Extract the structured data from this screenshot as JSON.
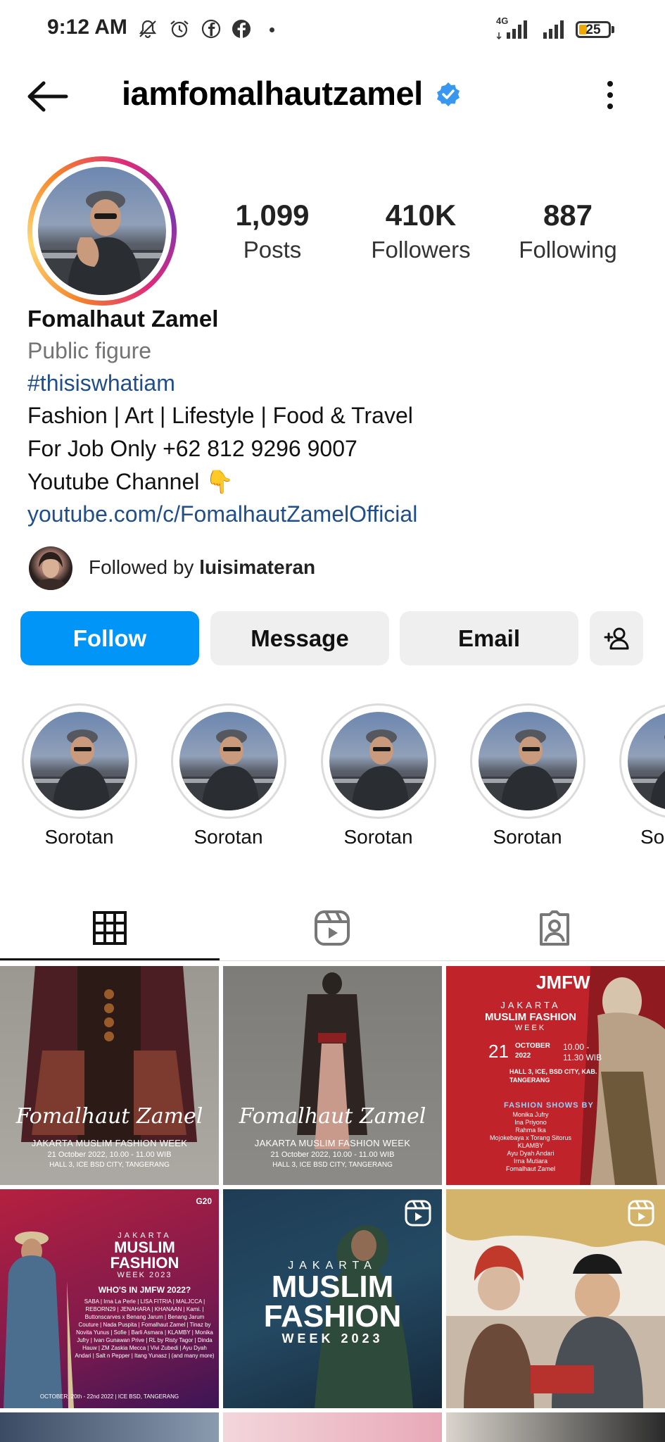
{
  "status_bar": {
    "time": "9:12 AM",
    "icons": [
      "mute-icon",
      "alarm-icon",
      "facebook-icon",
      "facebook-icon",
      "dot-icon",
      "signal-4g-icon",
      "signal-icon"
    ],
    "network": "4G",
    "battery": "25"
  },
  "header": {
    "back_icon": "arrow-left-icon",
    "username": "iamfomalhautzamel",
    "verified_icon": "verified-badge-icon",
    "menu_icon": "more-vertical-icon"
  },
  "profile": {
    "stats": [
      {
        "value": "1,099",
        "label": "Posts"
      },
      {
        "value": "410K",
        "label": "Followers"
      },
      {
        "value": "887",
        "label": "Following"
      }
    ],
    "name": "Fomalhaut Zamel",
    "category": "Public figure",
    "hashtag": "#thisiswhatiam",
    "bio_lines": [
      "Fashion | Art | Lifestyle | Food & Travel",
      "For Job Only +62 812 9296 9007",
      "Youtube Channel 👇"
    ],
    "link": "youtube.com/c/FomalhautZamelOfficial",
    "followed_by_prefix": "Followed by",
    "followed_by_user": "luisimateran"
  },
  "actions": {
    "follow": "Follow",
    "message": "Message",
    "email": "Email",
    "suggest_icon": "add-person-icon"
  },
  "highlights": [
    {
      "label": "Sorotan"
    },
    {
      "label": "Sorotan"
    },
    {
      "label": "Sorotan"
    },
    {
      "label": "Sorotan"
    },
    {
      "label": "Sorotan"
    }
  ],
  "tabs": [
    {
      "icon": "grid-icon",
      "active": true
    },
    {
      "icon": "reels-icon",
      "active": false
    },
    {
      "icon": "tagged-icon",
      "active": false
    }
  ],
  "posts": [
    {
      "script": "Fomalhaut Zamel",
      "line1": "JAKARTA MUSLIM FASHION WEEK",
      "line2": "21 October 2022, 10.00 - 11.00 WIB",
      "line3": "HALL 3, ICE BSD CITY, TANGERANG"
    },
    {
      "script": "Fomalhaut Zamel",
      "line1": "JAKARTA MUSLIM FASHION WEEK",
      "line2": "21 October 2022, 10.00 - 11.00 WIB",
      "line3": "HALL 3, ICE BSD CITY, TANGERANG"
    },
    {
      "brand": "JMFW",
      "title1": "JAKARTA",
      "title2": "MUSLIM FASHION",
      "title3": "WEEK",
      "day": "21",
      "month": "OCTOBER",
      "year": "2022",
      "time": "10.00 - 11.30 WIB",
      "venue": "HALL 3, ICE, BSD CITY, KAB. TANGERANG",
      "shows_title": "FASHION SHOWS BY",
      "shows": [
        "Monika Jufry",
        "Ina Priyono",
        "Rahma Ika",
        "Mojokebaya x Torang Sitorus",
        "KLAMBY",
        "Ayu Dyah Andari",
        "Irna Mutiara",
        "Fomalhaut Zamel"
      ]
    },
    {
      "title1": "JAKARTA",
      "title2": "MUSLIM",
      "title3": "FASHION",
      "title4": "WEEK 2023",
      "question": "WHO'S IN JMFW 2022?",
      "names": "SABA | Irna La Perle | LISA FITRIA | MALJCCA | REBORN29 | JENAHARA | KHANAAN | Kami. | Buttonscarves x Benang Jarum | Benang Jarum Couture | Nada Puspita | Fomalhaut Zamel | Tinaz by Novita Yunus | Sofie | Barli Asmara | KLAMBY | Monika Jufry | Ivan Gunawan Prive | RL by Risty Tagor | Dinda Hauw | ZM Zaskia Mecca | Vivi Zubedi | Ayu Dyah Andari | Salt n Pepper | Itang Yunasz | (and many more)",
      "date": "OCTOBER, 20th - 22nd 2022 | ICE BSD, TANGERANG",
      "g20": "G20"
    },
    {
      "title1": "JAKARTA",
      "title2": "MUSLIM",
      "title3": "FASHION",
      "title4": "WEEK 2023"
    },
    {
      "type": "reel"
    }
  ]
}
